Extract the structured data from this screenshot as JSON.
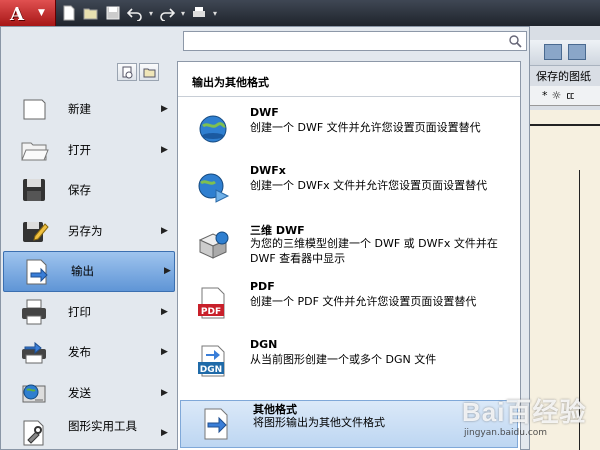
{
  "app_button": {
    "logo": "A"
  },
  "background": {
    "ribbon_label": "保存的图纸",
    "row3_items": [
      "*",
      "☼",
      "ㄸ"
    ]
  },
  "search": {
    "placeholder": ""
  },
  "left_menu": {
    "items": [
      {
        "label": "新建",
        "icon": "new-document-icon",
        "has_arrow": true
      },
      {
        "label": "打开",
        "icon": "open-folder-icon",
        "has_arrow": true
      },
      {
        "label": "保存",
        "icon": "save-disk-icon",
        "has_arrow": false
      },
      {
        "label": "另存为",
        "icon": "save-as-icon",
        "has_arrow": true
      },
      {
        "label": "输出",
        "icon": "export-icon",
        "has_arrow": true,
        "active": true
      },
      {
        "label": "打印",
        "icon": "printer-icon",
        "has_arrow": true
      },
      {
        "label": "发布",
        "icon": "publish-icon",
        "has_arrow": true
      },
      {
        "label": "发送",
        "icon": "send-globe-icon",
        "has_arrow": true
      },
      {
        "label": "图形实用工具",
        "icon": "drawing-utilities-icon",
        "has_arrow": true
      }
    ]
  },
  "submenu": {
    "header": "输出为其他格式",
    "items": [
      {
        "title": "DWF",
        "desc": "创建一个 DWF 文件并允许您设置页面设置替代",
        "icon": "dwf-globe-icon"
      },
      {
        "title": "DWFx",
        "desc": "创建一个 DWFx 文件并允许您设置页面设置替代",
        "icon": "dwfx-globe-icon"
      },
      {
        "title": "三维 DWF",
        "desc": "为您的三维模型创建一个 DWF 或 DWFx 文件并在 DWF 查看器中显示",
        "icon": "3d-dwf-icon"
      },
      {
        "title": "PDF",
        "desc": "创建一个 PDF 文件并允许您设置页面设置替代",
        "icon": "pdf-icon"
      },
      {
        "title": "DGN",
        "desc": "从当前图形创建一个或多个 DGN 文件",
        "icon": "dgn-icon"
      },
      {
        "title": "其他格式",
        "desc": "将图形输出为其他文件格式",
        "icon": "other-formats-icon",
        "active": true
      }
    ]
  },
  "watermark": {
    "brand": "Bai百经验",
    "url": "jingyan.baidu.com"
  },
  "colors": {
    "accent": "#5f95d6",
    "app_red": "#c02020"
  }
}
